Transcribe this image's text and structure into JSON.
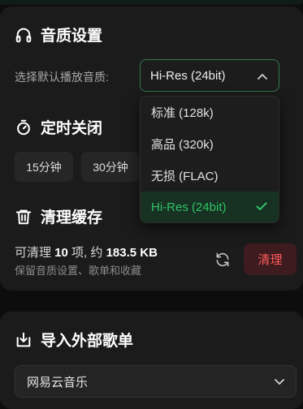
{
  "audio_quality": {
    "title": "音质设置",
    "label": "选择默认播放音质:",
    "selected": "Hi-Res (24bit)",
    "options": [
      "标准 (128k)",
      "高品 (320k)",
      "无损 (FLAC)",
      "Hi-Res (24bit)"
    ],
    "accent_color": "#2fc468"
  },
  "timer": {
    "title": "定时关闭",
    "chips": [
      "15分钟",
      "30分钟"
    ]
  },
  "cache": {
    "title": "清理缓存",
    "prefix": "可清理",
    "count": "10",
    "count_unit": "项, 约",
    "size": "183.5 KB",
    "note": "保留音质设置、歌单和收藏",
    "clean_label": "清理",
    "danger_color": "#ff5a5a"
  },
  "import": {
    "title": "导入外部歌单",
    "source": "网易云音乐"
  },
  "icons": [
    "headphones-icon",
    "timer-icon",
    "trash-icon",
    "refresh-icon",
    "import-icon",
    "chevron-up-icon",
    "chevron-down-icon",
    "check-icon"
  ]
}
